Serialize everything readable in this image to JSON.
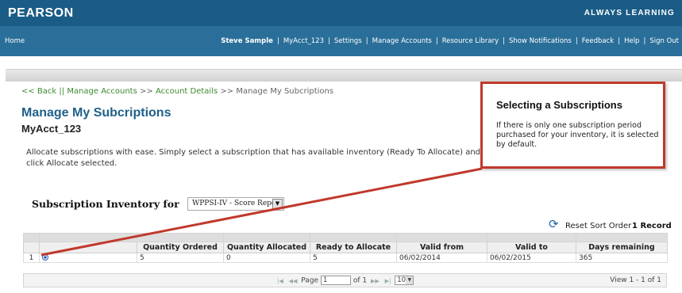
{
  "header": {
    "brand": "PEARSON",
    "tagline": "ALWAYS LEARNING"
  },
  "nav": {
    "home": "Home",
    "user": "Steve Sample",
    "items": [
      "MyAcct_123",
      "Settings",
      "Manage Accounts",
      "Resource Library",
      "Show Notifications",
      "Feedback",
      "Help",
      "Sign Out"
    ]
  },
  "breadcrumb": {
    "back": "<< Back",
    "sep1": " || ",
    "manage_accounts": "Manage Accounts",
    "sep2": " >> ",
    "account_details": "Account Details",
    "sep3": " >> ",
    "current": "Manage My Subcriptions"
  },
  "page": {
    "title": "Manage My Subcriptions",
    "account": "MyAcct_123",
    "description": "Allocate subscriptions with ease. Simply select a subscription that has available inventory (Ready To Allocate) and click Allocate selected."
  },
  "inventory": {
    "label": "Subscription Inventory for",
    "selected": "WPPSI-IV - Score Report"
  },
  "grid_meta": {
    "reset_label": "Reset Sort Order",
    "record_count": "1 Record"
  },
  "table": {
    "columns": [
      "",
      "",
      "Quantity Ordered",
      "Quantity Allocated",
      "Ready to Allocate",
      "Valid from",
      "Valid to",
      "Days remaining"
    ],
    "rows": [
      {
        "num": "1",
        "selected": true,
        "ordered": "5",
        "allocated": "0",
        "ready": "5",
        "from": "06/02/2014",
        "to": "06/02/2015",
        "days": "365"
      }
    ]
  },
  "pager": {
    "page_label": "Page",
    "page_value": "1",
    "of_label": "of 1",
    "page_size": "10",
    "view_text": "View 1 - 1 of 1"
  },
  "callout": {
    "title": "Selecting a Subscriptions",
    "body": "If there is only one subscription period purchased for your inventory, it is selected by default."
  },
  "colors": {
    "header": "#1a5c86",
    "nav": "#2a6f99",
    "title": "#1f5f8a",
    "link": "#3d8a2f",
    "callout_border": "#c0392b"
  },
  "icons": {
    "reset": "refresh-icon",
    "radio": "radio-selected-icon"
  }
}
